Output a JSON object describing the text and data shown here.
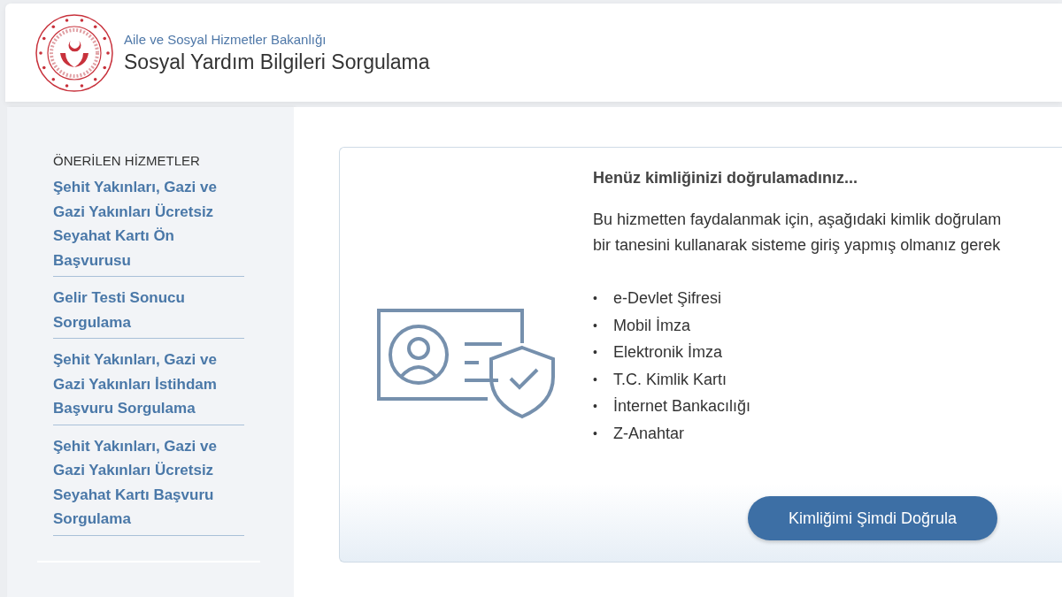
{
  "header": {
    "ministry": "Aile ve Sosyal Hizmetler Bakanlığı",
    "title": "Sosyal Yardım Bilgileri Sorgulama"
  },
  "sidebar": {
    "heading": "ÖNERİLEN HİZMETLER",
    "items": [
      {
        "label": "Şehit Yakınları, Gazi ve Gazi Yakınları Ücretsiz Seyahat Kartı Ön Başvurusu"
      },
      {
        "label": "Gelir Testi Sonucu Sorgulama"
      },
      {
        "label": "Şehit Yakınları, Gazi ve Gazi Yakınları İstihdam Başvuru Sorgulama"
      },
      {
        "label": "Şehit Yakınları, Gazi ve Gazi Yakınları Ücretsiz Seyahat Kartı Başvuru Sorgulama"
      }
    ]
  },
  "notice": {
    "heading": "Henüz kimliğinizi doğrulamadınız...",
    "lines": [
      "Bu hizmetten faydalanmak için, aşağıdaki kimlik doğrulam",
      "bir tanesini kullanarak sisteme giriş yapmış olmanız gerek"
    ],
    "bullet": "•",
    "methods": [
      "e-Devlet Şifresi",
      "Mobil İmza",
      "Elektronik İmza",
      "T.C. Kimlik Kartı",
      "İnternet Bankacılığı",
      "Z-Anahtar"
    ],
    "button": "Kimliğimi Şimdi Doğrula"
  }
}
